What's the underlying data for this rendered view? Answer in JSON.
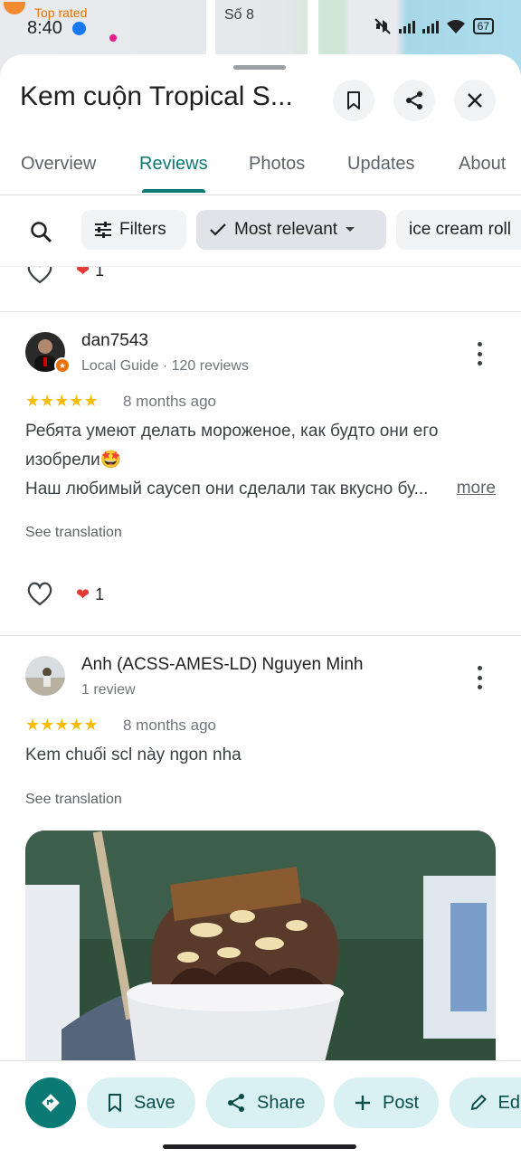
{
  "map": {
    "label_top": "Top rated",
    "label_street": "Số 8"
  },
  "status": {
    "time": "8:40",
    "battery": "67"
  },
  "place": {
    "title": "Kem cuộn Tropical S..."
  },
  "tabs": [
    "Overview",
    "Reviews",
    "Photos",
    "Updates",
    "About"
  ],
  "active_tab": "Reviews",
  "filters": {
    "filters_label": "Filters",
    "sort_label": "Most relevant",
    "topic_chip": "ice cream roll"
  },
  "prev_review": {
    "likes": "1"
  },
  "reviews": [
    {
      "name": "dan7543",
      "meta": "Local Guide · 120 reviews",
      "stars": "★★★★★",
      "rating": 5,
      "ago": "8 months ago",
      "text_line1": "Ребята умеют делать мороженое, как будто они его",
      "text_line2": "изобрели🤩",
      "text_line3": "Наш любимый саусеп они сделали так вкусно бу...",
      "more": "more",
      "see_translation": "See translation",
      "likes": "1"
    },
    {
      "name": "Anh (ACSS-AMES-LD) Nguyen Minh",
      "meta": "1 review",
      "stars": "★★★★★",
      "rating": 5,
      "ago": "8 months ago",
      "text_line1": "Kem chuối scl này ngon nha",
      "see_translation": "See translation"
    }
  ],
  "actions": {
    "save": "Save",
    "share": "Share",
    "post": "Post",
    "edit": "Edit"
  },
  "colors": {
    "accent": "#0b7a75",
    "action_bg": "#d9f1f3",
    "star": "#fbbc04"
  }
}
